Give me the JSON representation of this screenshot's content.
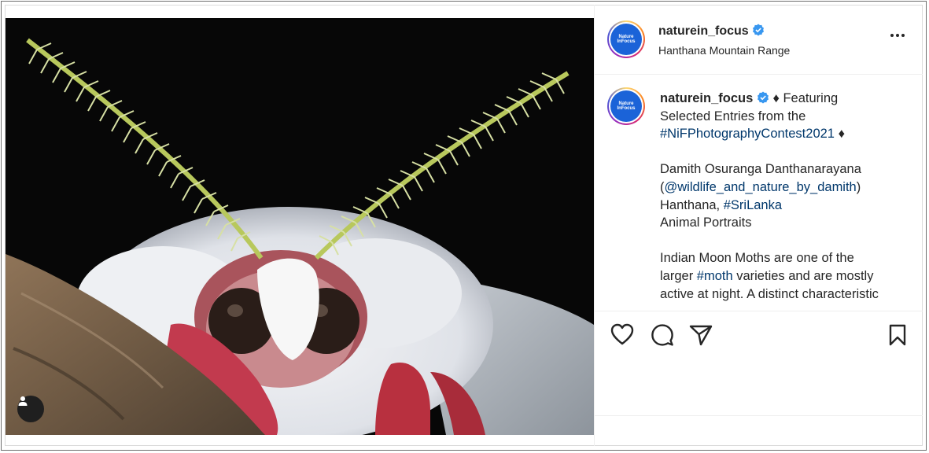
{
  "post": {
    "username": "naturein_focus",
    "location": "Hanthana Mountain Range",
    "avatar_text": "Nature\nInFocus",
    "caption": {
      "line1_rest": " ♦ Featuring",
      "line2": "Selected Entries from the",
      "hashtag_contest": "#NiFPhotographyContest2021",
      "diamond": " ♦",
      "photographer": "Damith Osuranga Danthanarayana",
      "handle_open": "(",
      "handle": "@wildlife_and_nature_by_damith",
      "handle_close": ")",
      "place_prefix": "Hanthana, ",
      "hashtag_country": "#SriLanka",
      "category": "Animal Portraits",
      "para1": "Indian Moon Moths are one of the",
      "para2_pre": "larger ",
      "hashtag_moth": "#moth",
      "para2_post": " varieties and are mostly",
      "para3": "active at night. A distinct characteristic"
    }
  },
  "icons": {
    "verified": "verified-badge-icon",
    "more": "more-options-icon",
    "like": "heart-icon",
    "comment": "comment-icon",
    "share": "paper-plane-icon",
    "save": "bookmark-icon",
    "user_tag": "user-icon"
  },
  "colors": {
    "verified_blue": "#3897f0",
    "link_blue": "#00376b",
    "moth_red": "#c23a4e",
    "antenna_green": "#c8d67a"
  }
}
